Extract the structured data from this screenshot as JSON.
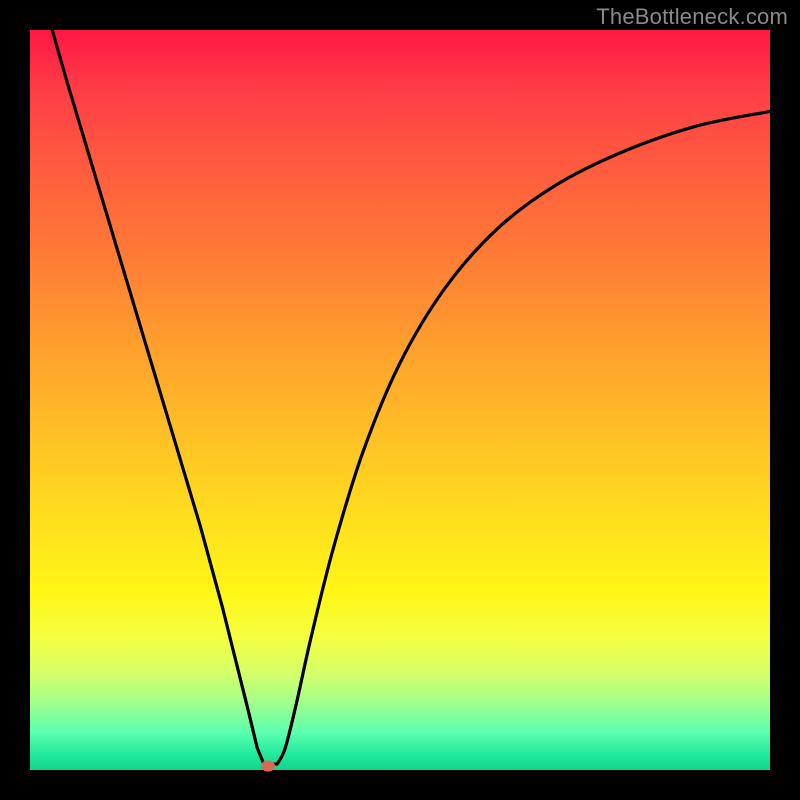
{
  "watermark": "TheBottleneck.com",
  "colors": {
    "frame": "#000000",
    "gradient_top": "#ff1744",
    "gradient_bottom": "#14d48a",
    "curve": "#000000",
    "marker": "#d96a5a"
  },
  "chart_data": {
    "type": "line",
    "title": "",
    "xlabel": "",
    "ylabel": "",
    "xlim": [
      0,
      100
    ],
    "ylim": [
      0,
      100
    ],
    "grid": false,
    "legend": false,
    "series": [
      {
        "name": "curve",
        "x": [
          3,
          5,
          8,
          11,
          14,
          17,
          20,
          23,
          26,
          28,
          29.5,
          30.7,
          31.6,
          32.5,
          33.4,
          34.5,
          36,
          38,
          41,
          45,
          50,
          56,
          63,
          71,
          80,
          90,
          100
        ],
        "y": [
          100,
          93,
          83,
          73,
          63,
          53,
          43,
          33,
          22,
          14,
          8,
          3,
          0.8,
          0.6,
          0.8,
          3,
          9,
          18,
          30,
          43,
          55,
          65,
          73,
          79,
          83.5,
          87,
          89
        ]
      }
    ],
    "marker": {
      "x": 32.2,
      "y": 0.6
    },
    "notch": {
      "x_start": 31.6,
      "x_end": 33.2,
      "y": 0.8
    }
  }
}
